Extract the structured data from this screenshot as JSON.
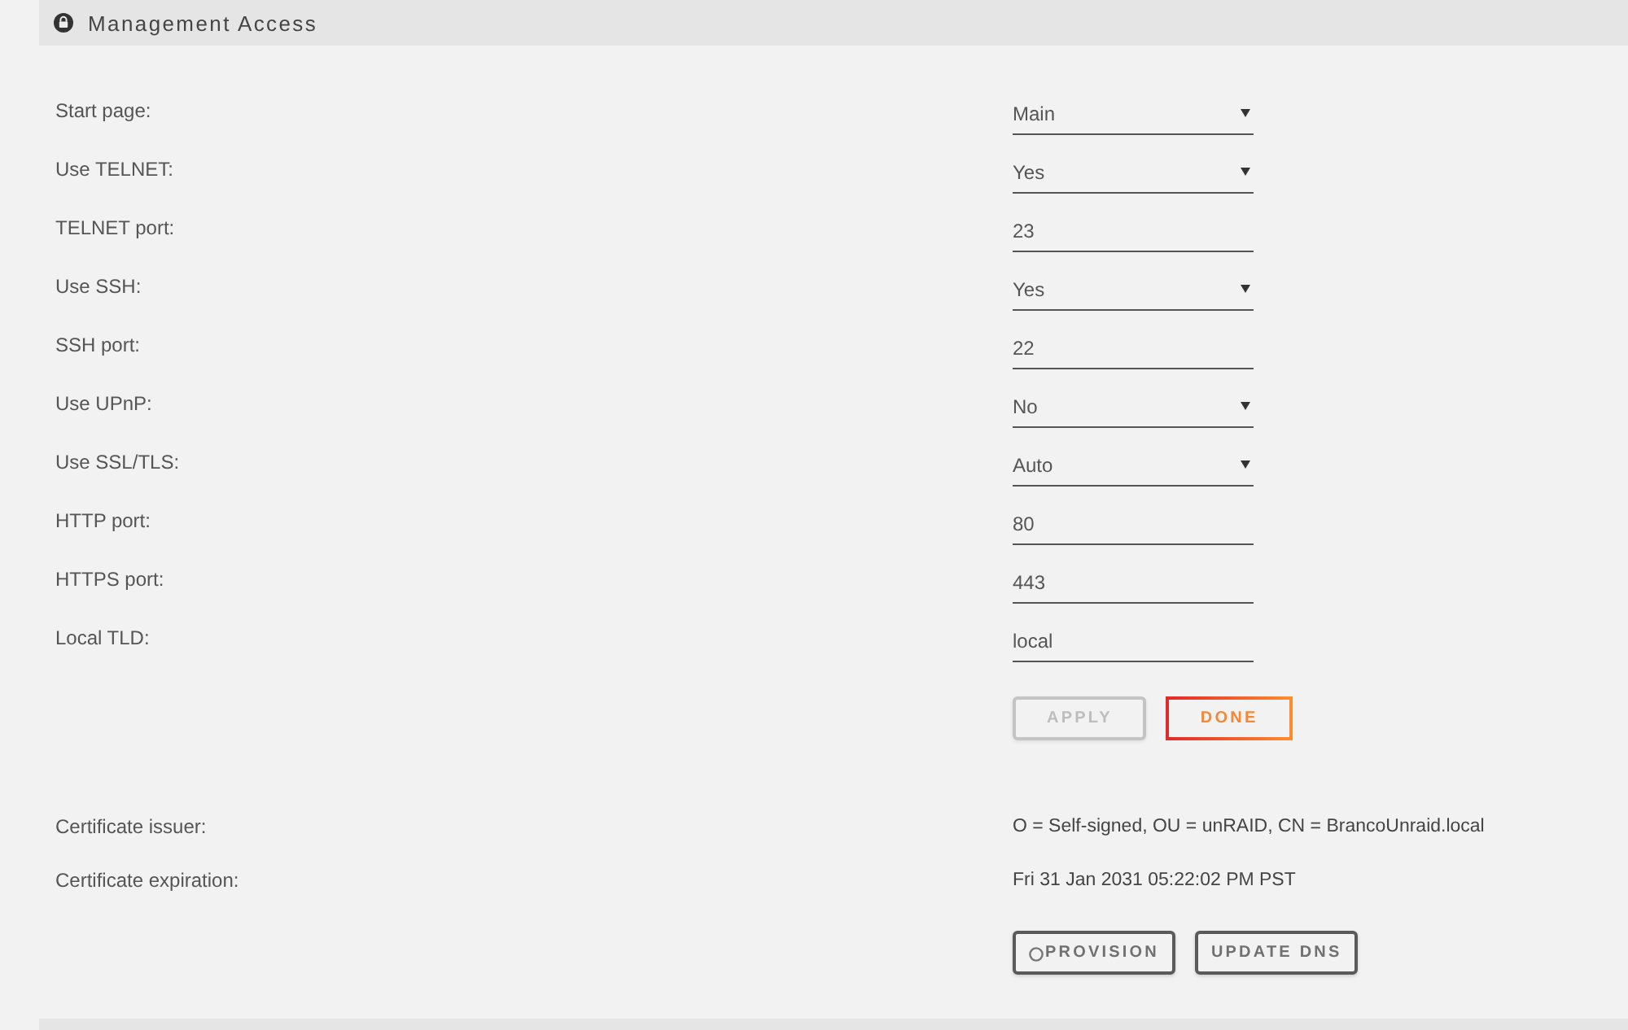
{
  "section": {
    "title": "Management Access"
  },
  "settings": [
    {
      "label": "Start page:",
      "kind": "select",
      "value": "Main"
    },
    {
      "label": "Use TELNET:",
      "kind": "select",
      "value": "Yes"
    },
    {
      "label": "TELNET port:",
      "kind": "text",
      "value": "23"
    },
    {
      "label": "Use SSH:",
      "kind": "select",
      "value": "Yes"
    },
    {
      "label": "SSH port:",
      "kind": "text",
      "value": "22"
    },
    {
      "label": "Use UPnP:",
      "kind": "select",
      "value": "No"
    },
    {
      "label": "Use SSL/TLS:",
      "kind": "select",
      "value": "Auto"
    },
    {
      "label": "HTTP port:",
      "kind": "text",
      "value": "80"
    },
    {
      "label": "HTTPS port:",
      "kind": "text",
      "value": "443"
    },
    {
      "label": "Local TLD:",
      "kind": "text",
      "value": "local"
    }
  ],
  "form_buttons": [
    {
      "label": "APPLY",
      "disabled": true
    },
    {
      "label": "DONE",
      "disabled": false
    }
  ],
  "certificate": [
    {
      "label": "Certificate issuer:",
      "value": "O = Self-signed, OU = unRAID, CN = BrancoUnraid.local"
    },
    {
      "label": "Certificate expiration:",
      "value": "Fri 31 Jan 2031 05:22:02 PM PST"
    }
  ],
  "certificate_buttons": [
    {
      "label": "PROVISION",
      "disabled": false,
      "busy": true
    },
    {
      "label": "UPDATE DNS",
      "disabled": false,
      "busy": false
    }
  ]
}
